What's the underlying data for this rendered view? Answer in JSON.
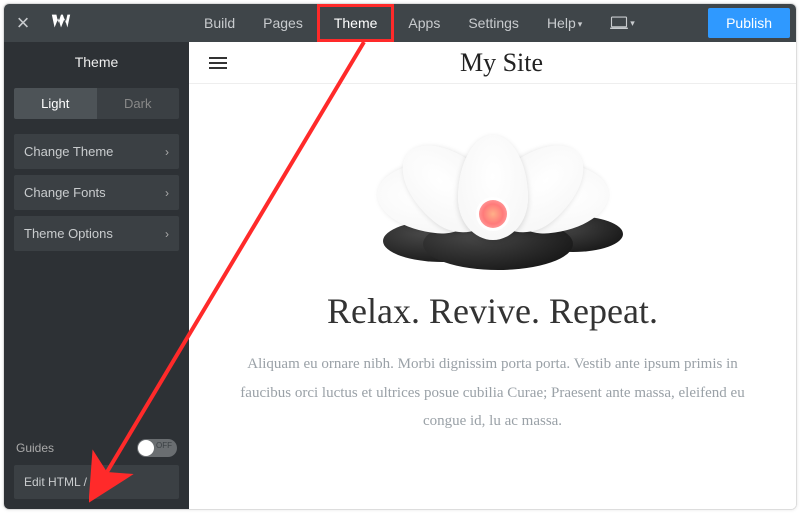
{
  "topbar": {
    "nav": {
      "build": "Build",
      "pages": "Pages",
      "theme": "Theme",
      "apps": "Apps",
      "settings": "Settings",
      "help": "Help"
    },
    "publish": "Publish"
  },
  "sidebar": {
    "title": "Theme",
    "tabs": {
      "light": "Light",
      "dark": "Dark"
    },
    "items": {
      "change_theme": "Change Theme",
      "change_fonts": "Change Fonts",
      "theme_options": "Theme Options"
    },
    "guides_label": "Guides",
    "guides_toggle": "OFF",
    "edit_html_css": "Edit HTML / CSS"
  },
  "site": {
    "title": "My Site",
    "headline": "Relax. Revive. Repeat.",
    "body": "Aliquam eu ornare nibh. Morbi dignissim porta porta. Vestib ante ipsum primis in faucibus orci luctus et ultrices posue cubilia Curae; Praesent ante massa, eleifend eu congue id, lu ac massa."
  },
  "annotation": {
    "highlight_target": "theme-tab",
    "arrow_target": "edit-html-css-button"
  }
}
